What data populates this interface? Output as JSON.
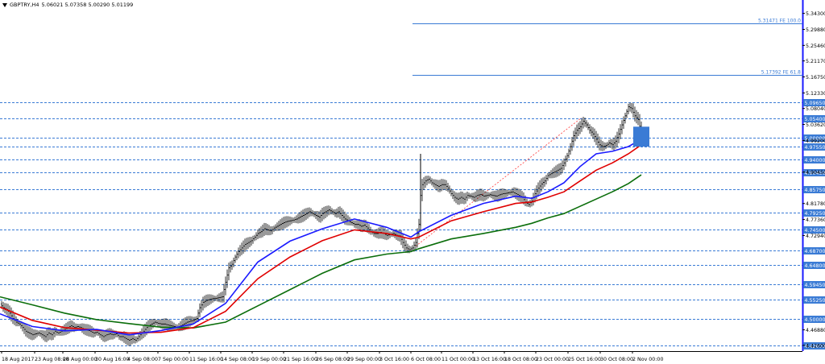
{
  "window": {
    "symbol": "GBPTRY,H4",
    "ohlc": "5.06021 5.07358 5.00290 5.01199"
  },
  "colors": {
    "background": "#ffffff",
    "candle": "#000000",
    "ma_fast": "#1a1aff",
    "ma_mid": "#e00000",
    "ma_slow": "#0b6e0b",
    "levels": "#3a7bd5",
    "fib_lines": "#3a7bd5",
    "trendline": "#ff3b3b",
    "price_tag": "#3a7bd5",
    "right_border": "#1a1aff"
  },
  "chart_data": {
    "type": "line",
    "title": "",
    "xlabel": "",
    "ylabel": "",
    "ylim": [
      4.41,
      5.38
    ],
    "y_ticks": [
      "5.34300",
      "5.29880",
      "5.25460",
      "5.21170",
      "5.16750",
      "5.12330",
      "5.08040",
      "5.03620",
      "4.99200",
      "4.90450",
      "4.81780",
      "4.77360",
      "4.72940",
      "4.46880",
      "4.42600"
    ],
    "x_ticks": [
      "18 Aug 2017",
      "23 Aug 08:00",
      "28 Aug 00:00",
      "30 Aug 16:00",
      "4 Sep 08:00",
      "7 Sep 00:00",
      "11 Sep 16:00",
      "14 Sep 08:00",
      "19 Sep 00:00",
      "21 Sep 16:00",
      "26 Sep 08:00",
      "29 Sep 00:00",
      "3 Oct 16:00",
      "6 Oct 08:00",
      "11 Oct 00:00",
      "13 Oct 16:00",
      "18 Oct 08:00",
      "23 Oct 00:00",
      "25 Oct 16:00",
      "30 Oct 08:00",
      "2 Nov 00:00"
    ],
    "levels": [
      {
        "label": "5.09650",
        "value": 5.0965
      },
      {
        "label": "5.05400",
        "value": 5.054
      },
      {
        "label": "5.00000",
        "value": 5.0
      },
      {
        "label": "4.97550",
        "value": 4.9755
      },
      {
        "label": "4.94000",
        "value": 4.94
      },
      {
        "label": "4.90450",
        "value": 4.9045
      },
      {
        "label": "4.85750",
        "value": 4.8575
      },
      {
        "label": "4.79250",
        "value": 4.7925
      },
      {
        "label": "4.74500",
        "value": 4.745
      },
      {
        "label": "4.68700",
        "value": 4.687
      },
      {
        "label": "4.64800",
        "value": 4.648
      },
      {
        "label": "4.59450",
        "value": 4.5945
      },
      {
        "label": "4.55250",
        "value": 4.5525
      },
      {
        "label": "4.50000",
        "value": 4.5
      },
      {
        "label": "4.42600",
        "value": 4.426
      }
    ],
    "fib_levels": [
      {
        "label": "5.31471 FE 100.0",
        "value": 5.31471
      },
      {
        "label": "5.17392 FE 61.8",
        "value": 5.17392
      }
    ],
    "current_price": 5.01199,
    "series": [
      {
        "kind": "close",
        "points": [
          [
            0,
            4.54
          ],
          [
            4,
            4.53
          ],
          [
            8,
            4.525
          ],
          [
            12,
            4.515
          ],
          [
            16,
            4.5
          ],
          [
            20,
            4.49
          ],
          [
            24,
            4.485
          ],
          [
            28,
            4.475
          ],
          [
            32,
            4.465
          ],
          [
            36,
            4.46
          ],
          [
            40,
            4.455
          ],
          [
            44,
            4.458
          ],
          [
            48,
            4.46
          ],
          [
            52,
            4.455
          ],
          [
            56,
            4.45
          ],
          [
            60,
            4.46
          ],
          [
            64,
            4.455
          ],
          [
            68,
            4.465
          ],
          [
            72,
            4.46
          ],
          [
            76,
            4.465
          ],
          [
            80,
            4.47
          ],
          [
            84,
            4.475
          ],
          [
            88,
            4.48
          ],
          [
            92,
            4.475
          ],
          [
            96,
            4.478
          ],
          [
            100,
            4.475
          ],
          [
            104,
            4.47
          ],
          [
            108,
            4.468
          ],
          [
            112,
            4.465
          ],
          [
            116,
            4.46
          ],
          [
            120,
            4.462
          ],
          [
            124,
            4.455
          ],
          [
            128,
            4.45
          ],
          [
            132,
            4.455
          ],
          [
            136,
            4.458
          ],
          [
            140,
            4.455
          ],
          [
            144,
            4.458
          ],
          [
            148,
            4.45
          ],
          [
            152,
            4.45
          ],
          [
            156,
            4.445
          ],
          [
            160,
            4.44
          ],
          [
            164,
            4.445
          ],
          [
            168,
            4.44
          ],
          [
            172,
            4.45
          ],
          [
            176,
            4.46
          ],
          [
            180,
            4.47
          ],
          [
            184,
            4.48
          ],
          [
            188,
            4.485
          ],
          [
            192,
            4.49
          ],
          [
            196,
            4.487
          ],
          [
            200,
            4.485
          ],
          [
            204,
            4.485
          ],
          [
            208,
            4.482
          ],
          [
            212,
            4.48
          ],
          [
            216,
            4.478
          ],
          [
            220,
            4.475
          ],
          [
            224,
            4.48
          ],
          [
            228,
            4.485
          ],
          [
            232,
            4.49
          ],
          [
            236,
            4.493
          ],
          [
            240,
            4.495
          ],
          [
            244,
            4.5
          ],
          [
            248,
            4.53
          ],
          [
            252,
            4.545
          ],
          [
            256,
            4.55
          ],
          [
            260,
            4.553
          ],
          [
            264,
            4.555
          ],
          [
            268,
            4.556
          ],
          [
            272,
            4.558
          ],
          [
            276,
            4.56
          ],
          [
            280,
            4.6
          ],
          [
            284,
            4.64
          ],
          [
            288,
            4.65
          ],
          [
            292,
            4.67
          ],
          [
            296,
            4.685
          ],
          [
            300,
            4.695
          ],
          [
            304,
            4.705
          ],
          [
            308,
            4.71
          ],
          [
            312,
            4.715
          ],
          [
            316,
            4.725
          ],
          [
            320,
            4.735
          ],
          [
            324,
            4.74
          ],
          [
            328,
            4.748
          ],
          [
            332,
            4.745
          ],
          [
            336,
            4.742
          ],
          [
            340,
            4.75
          ],
          [
            344,
            4.755
          ],
          [
            348,
            4.76
          ],
          [
            352,
            4.765
          ],
          [
            356,
            4.768
          ],
          [
            360,
            4.77
          ],
          [
            364,
            4.772
          ],
          [
            368,
            4.775
          ],
          [
            372,
            4.78
          ],
          [
            376,
            4.785
          ],
          [
            380,
            4.79
          ],
          [
            384,
            4.795
          ],
          [
            388,
            4.79
          ],
          [
            392,
            4.785
          ],
          [
            396,
            4.78
          ],
          [
            400,
            4.79
          ],
          [
            404,
            4.795
          ],
          [
            408,
            4.8
          ],
          [
            412,
            4.795
          ],
          [
            416,
            4.79
          ],
          [
            420,
            4.795
          ],
          [
            424,
            4.785
          ],
          [
            428,
            4.775
          ],
          [
            432,
            4.77
          ],
          [
            436,
            4.765
          ],
          [
            440,
            4.76
          ],
          [
            444,
            4.76
          ],
          [
            448,
            4.755
          ],
          [
            452,
            4.758
          ],
          [
            456,
            4.75
          ],
          [
            460,
            4.74
          ],
          [
            464,
            4.735
          ],
          [
            468,
            4.735
          ],
          [
            472,
            4.738
          ],
          [
            476,
            4.735
          ],
          [
            480,
            4.73
          ],
          [
            484,
            4.732
          ],
          [
            488,
            4.735
          ],
          [
            492,
            4.73
          ],
          [
            496,
            4.728
          ],
          [
            500,
            4.71
          ],
          [
            504,
            4.695
          ],
          [
            508,
            4.69
          ],
          [
            512,
            4.695
          ],
          [
            516,
            4.71
          ],
          [
            520,
            4.76
          ],
          [
            522,
            4.84
          ],
          [
            524,
            4.87
          ],
          [
            528,
            4.88
          ],
          [
            532,
            4.885
          ],
          [
            536,
            4.875
          ],
          [
            540,
            4.87
          ],
          [
            544,
            4.865
          ],
          [
            548,
            4.87
          ],
          [
            552,
            4.87
          ],
          [
            556,
            4.86
          ],
          [
            560,
            4.845
          ],
          [
            564,
            4.835
          ],
          [
            568,
            4.83
          ],
          [
            572,
            4.835
          ],
          [
            576,
            4.83
          ],
          [
            580,
            4.84
          ],
          [
            584,
            4.838
          ],
          [
            588,
            4.835
          ],
          [
            592,
            4.84
          ],
          [
            596,
            4.843
          ],
          [
            600,
            4.838
          ],
          [
            604,
            4.84
          ],
          [
            608,
            4.842
          ],
          [
            612,
            4.84
          ],
          [
            616,
            4.838
          ],
          [
            620,
            4.842
          ],
          [
            624,
            4.845
          ],
          [
            628,
            4.846
          ],
          [
            632,
            4.848
          ],
          [
            636,
            4.85
          ],
          [
            640,
            4.845
          ],
          [
            644,
            4.84
          ],
          [
            648,
            4.835
          ],
          [
            652,
            4.822
          ],
          [
            656,
            4.815
          ],
          [
            660,
            4.825
          ],
          [
            664,
            4.845
          ],
          [
            668,
            4.86
          ],
          [
            672,
            4.872
          ],
          [
            676,
            4.88
          ],
          [
            680,
            4.895
          ],
          [
            684,
            4.9
          ],
          [
            688,
            4.905
          ],
          [
            692,
            4.91
          ],
          [
            696,
            4.915
          ],
          [
            700,
            4.93
          ],
          [
            704,
            4.95
          ],
          [
            708,
            4.975
          ],
          [
            712,
            5.005
          ],
          [
            716,
            5.02
          ],
          [
            720,
            5.03
          ],
          [
            724,
            5.045
          ],
          [
            728,
            5.035
          ],
          [
            732,
            5.02
          ],
          [
            736,
            5.01
          ],
          [
            740,
            4.995
          ],
          [
            744,
            4.98
          ],
          [
            748,
            4.975
          ],
          [
            752,
            4.978
          ],
          [
            756,
            4.985
          ],
          [
            760,
            4.98
          ],
          [
            764,
            4.99
          ],
          [
            768,
            5.01
          ],
          [
            772,
            5.035
          ],
          [
            776,
            5.06
          ],
          [
            780,
            5.085
          ],
          [
            784,
            5.08
          ],
          [
            788,
            5.06
          ],
          [
            792,
            5.05
          ],
          [
            796,
            5.01199
          ]
        ]
      },
      {
        "kind": "ma_fast",
        "points": [
          [
            0,
            4.513
          ],
          [
            40,
            4.478
          ],
          [
            80,
            4.466
          ],
          [
            120,
            4.47
          ],
          [
            160,
            4.455
          ],
          [
            200,
            4.467
          ],
          [
            240,
            4.485
          ],
          [
            280,
            4.542
          ],
          [
            320,
            4.656
          ],
          [
            360,
            4.714
          ],
          [
            400,
            4.748
          ],
          [
            440,
            4.775
          ],
          [
            480,
            4.752
          ],
          [
            510,
            4.725
          ],
          [
            520,
            4.74
          ],
          [
            560,
            4.785
          ],
          [
            600,
            4.818
          ],
          [
            640,
            4.838
          ],
          [
            660,
            4.832
          ],
          [
            680,
            4.85
          ],
          [
            700,
            4.875
          ],
          [
            720,
            4.92
          ],
          [
            740,
            4.955
          ],
          [
            760,
            4.962
          ],
          [
            780,
            4.975
          ],
          [
            796,
            4.995
          ]
        ]
      },
      {
        "kind": "ma_mid",
        "points": [
          [
            0,
            4.532
          ],
          [
            40,
            4.495
          ],
          [
            80,
            4.475
          ],
          [
            120,
            4.468
          ],
          [
            160,
            4.46
          ],
          [
            200,
            4.462
          ],
          [
            240,
            4.475
          ],
          [
            280,
            4.52
          ],
          [
            320,
            4.61
          ],
          [
            360,
            4.67
          ],
          [
            400,
            4.715
          ],
          [
            440,
            4.745
          ],
          [
            480,
            4.735
          ],
          [
            510,
            4.72
          ],
          [
            520,
            4.725
          ],
          [
            560,
            4.77
          ],
          [
            600,
            4.795
          ],
          [
            640,
            4.818
          ],
          [
            660,
            4.822
          ],
          [
            680,
            4.835
          ],
          [
            700,
            4.85
          ],
          [
            720,
            4.88
          ],
          [
            740,
            4.91
          ],
          [
            760,
            4.93
          ],
          [
            780,
            4.955
          ],
          [
            796,
            4.98
          ]
        ]
      },
      {
        "kind": "ma_slow",
        "points": [
          [
            0,
            4.56
          ],
          [
            40,
            4.538
          ],
          [
            80,
            4.515
          ],
          [
            120,
            4.497
          ],
          [
            160,
            4.486
          ],
          [
            200,
            4.476
          ],
          [
            240,
            4.474
          ],
          [
            280,
            4.49
          ],
          [
            320,
            4.535
          ],
          [
            360,
            4.58
          ],
          [
            400,
            4.625
          ],
          [
            440,
            4.662
          ],
          [
            480,
            4.678
          ],
          [
            510,
            4.685
          ],
          [
            520,
            4.693
          ],
          [
            560,
            4.72
          ],
          [
            600,
            4.735
          ],
          [
            640,
            4.752
          ],
          [
            660,
            4.763
          ],
          [
            680,
            4.778
          ],
          [
            700,
            4.79
          ],
          [
            720,
            4.81
          ],
          [
            740,
            4.83
          ],
          [
            760,
            4.85
          ],
          [
            780,
            4.873
          ],
          [
            796,
            4.897
          ]
        ]
      }
    ]
  }
}
